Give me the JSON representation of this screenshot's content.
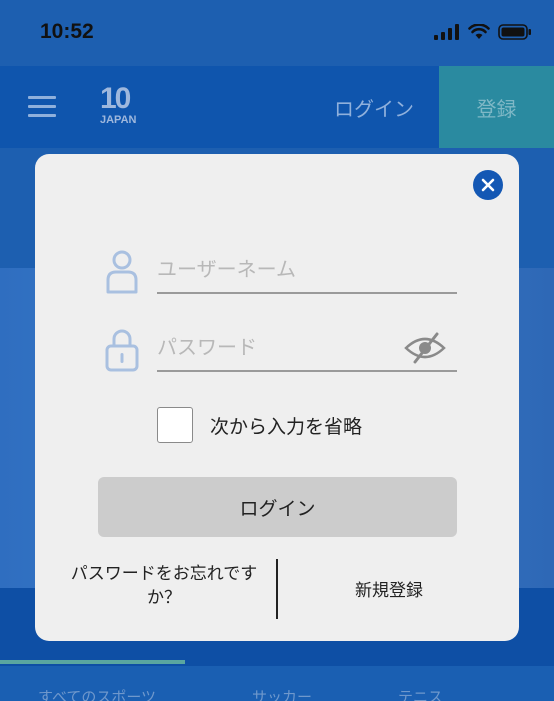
{
  "status_bar": {
    "time": "10:52"
  },
  "header": {
    "logo_number": "10",
    "logo_text": "JAPAN",
    "login_label": "ログイン",
    "register_label": "登録"
  },
  "background_tabs": [
    "すべてのスポーツ",
    "サッカー",
    "テニス"
  ],
  "login_modal": {
    "username_placeholder": "ユーザーネーム",
    "password_placeholder": "パスワード",
    "remember_label": "次から入力を省略",
    "login_button_label": "ログイン",
    "forgot_password_label": "パスワードをお忘れですか？",
    "register_label": "新規登録",
    "remember_checked": false
  },
  "colors": {
    "accent": "#1458b4",
    "modal_bg": "#efefef",
    "field_icon": "#a9c0e0",
    "button_bg": "#cccccc"
  }
}
